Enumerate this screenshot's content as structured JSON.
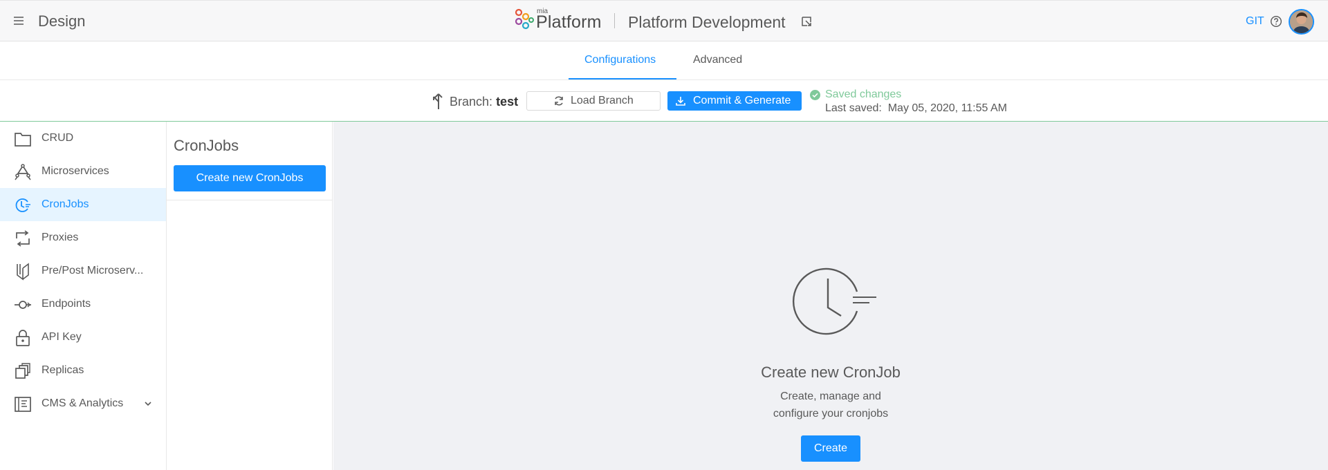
{
  "header": {
    "app_title": "Design",
    "brand_small": "mia",
    "brand_name": "Platform",
    "project_title": "Platform Development",
    "git_label": "GIT",
    "icons": [
      "menu-icon",
      "external-link-icon",
      "help-icon",
      "avatar"
    ]
  },
  "tabs": [
    {
      "label": "Configurations",
      "active": true
    },
    {
      "label": "Advanced",
      "active": false
    }
  ],
  "branch_bar": {
    "branch_prefix": "Branch:",
    "branch_name": "test",
    "load_label": "Load Branch",
    "commit_label": "Commit & Generate",
    "saved_status": "Saved changes",
    "last_saved_label": "Last saved:",
    "last_saved_value": "May 05, 2020, 11:55 AM"
  },
  "sidebar": {
    "items": [
      {
        "label": "CRUD",
        "icon": "folder-icon"
      },
      {
        "label": "Microservices",
        "icon": "microservices-icon"
      },
      {
        "label": "CronJobs",
        "icon": "cronjob-icon",
        "active": true
      },
      {
        "label": "Proxies",
        "icon": "proxy-icon"
      },
      {
        "label": "Pre/Post Microserv...",
        "icon": "prepost-icon"
      },
      {
        "label": "Endpoints",
        "icon": "endpoint-icon"
      },
      {
        "label": "API Key",
        "icon": "lock-icon"
      },
      {
        "label": "Replicas",
        "icon": "replicas-icon"
      },
      {
        "label": "CMS & Analytics",
        "icon": "cms-icon",
        "expandable": true
      }
    ]
  },
  "list_panel": {
    "title": "CronJobs",
    "create_label": "Create new CronJobs"
  },
  "empty_state": {
    "title": "Create new CronJob",
    "description": "Create, manage and configure your cronjobs",
    "button_label": "Create"
  },
  "colors": {
    "accent": "#1890ff",
    "success": "#7fc99a",
    "active_bg": "#e6f4ff",
    "main_bg": "#f0f1f4"
  }
}
